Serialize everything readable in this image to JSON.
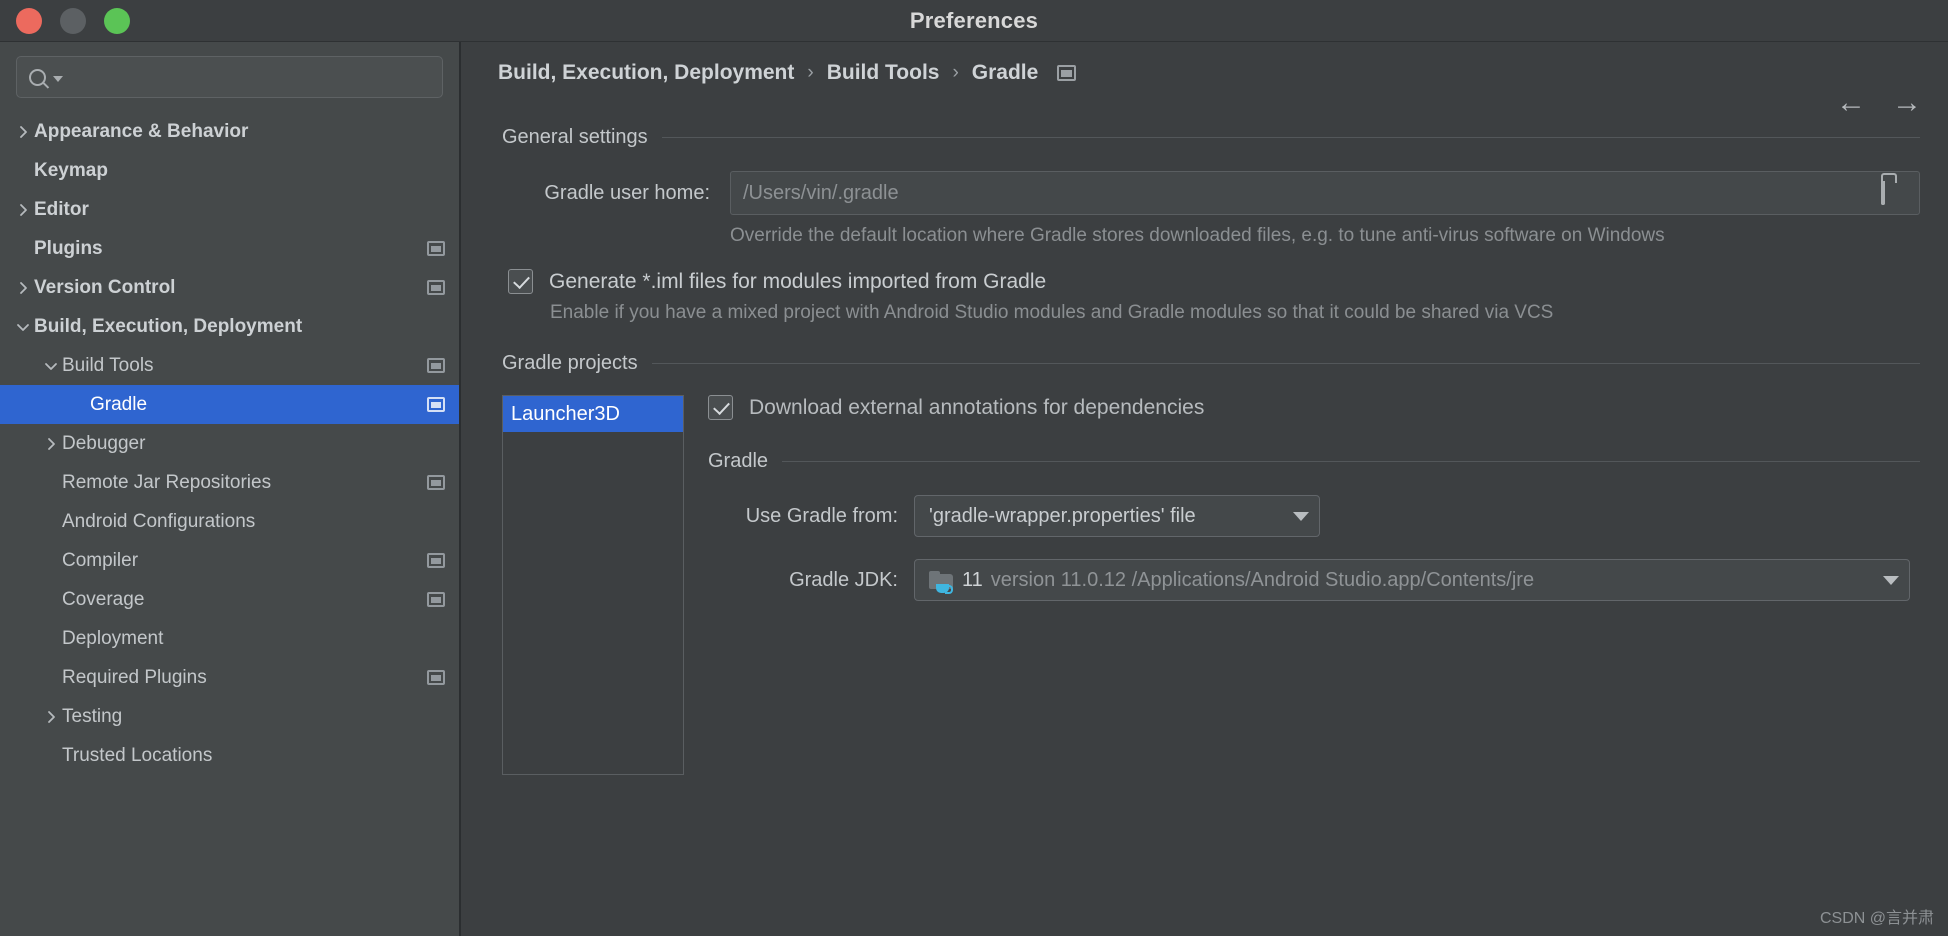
{
  "window": {
    "title": "Preferences",
    "traffic_lights": [
      "close",
      "minimize",
      "maximize"
    ]
  },
  "sidebar": {
    "search": {
      "value": "",
      "placeholder": ""
    },
    "items": [
      {
        "label": "Appearance & Behavior",
        "indent": 0,
        "chevron": "right",
        "bold": true,
        "project_icon": false,
        "selected": false
      },
      {
        "label": "Keymap",
        "indent": 0,
        "chevron": "none",
        "bold": true,
        "project_icon": false,
        "selected": false
      },
      {
        "label": "Editor",
        "indent": 0,
        "chevron": "right",
        "bold": true,
        "project_icon": false,
        "selected": false
      },
      {
        "label": "Plugins",
        "indent": 0,
        "chevron": "none",
        "bold": true,
        "project_icon": true,
        "selected": false
      },
      {
        "label": "Version Control",
        "indent": 0,
        "chevron": "right",
        "bold": true,
        "project_icon": true,
        "selected": false
      },
      {
        "label": "Build, Execution, Deployment",
        "indent": 0,
        "chevron": "down",
        "bold": true,
        "project_icon": false,
        "selected": false
      },
      {
        "label": "Build Tools",
        "indent": 1,
        "chevron": "down",
        "bold": false,
        "project_icon": true,
        "selected": false
      },
      {
        "label": "Gradle",
        "indent": 2,
        "chevron": "none",
        "bold": false,
        "project_icon": true,
        "selected": true
      },
      {
        "label": "Debugger",
        "indent": 1,
        "chevron": "right",
        "bold": false,
        "project_icon": false,
        "selected": false
      },
      {
        "label": "Remote Jar Repositories",
        "indent": 1,
        "chevron": "none",
        "bold": false,
        "project_icon": true,
        "selected": false
      },
      {
        "label": "Android Configurations",
        "indent": 1,
        "chevron": "none",
        "bold": false,
        "project_icon": false,
        "selected": false
      },
      {
        "label": "Compiler",
        "indent": 1,
        "chevron": "none",
        "bold": false,
        "project_icon": true,
        "selected": false
      },
      {
        "label": "Coverage",
        "indent": 1,
        "chevron": "none",
        "bold": false,
        "project_icon": true,
        "selected": false
      },
      {
        "label": "Deployment",
        "indent": 1,
        "chevron": "none",
        "bold": false,
        "project_icon": false,
        "selected": false
      },
      {
        "label": "Required Plugins",
        "indent": 1,
        "chevron": "none",
        "bold": false,
        "project_icon": true,
        "selected": false
      },
      {
        "label": "Testing",
        "indent": 1,
        "chevron": "right",
        "bold": false,
        "project_icon": false,
        "selected": false
      },
      {
        "label": "Trusted Locations",
        "indent": 1,
        "chevron": "none",
        "bold": false,
        "project_icon": false,
        "selected": false
      }
    ]
  },
  "breadcrumb": {
    "parts": [
      "Build, Execution, Deployment",
      "Build Tools",
      "Gradle"
    ],
    "separator": "›",
    "back_arrow": "←",
    "forward_arrow": "→"
  },
  "general_settings": {
    "section_title": "General settings",
    "gradle_user_home_label": "Gradle user home:",
    "gradle_user_home_value": "",
    "gradle_user_home_placeholder": "/Users/vin/.gradle",
    "gradle_user_home_hint": "Override the default location where Gradle stores downloaded files, e.g. to tune anti-virus software on Windows",
    "generate_iml_label": "Generate *.iml files for modules imported from Gradle",
    "generate_iml_checked": true,
    "generate_iml_hint": "Enable if you have a mixed project with Android Studio modules and Gradle modules so that it could be shared via VCS"
  },
  "gradle_projects": {
    "section_title": "Gradle projects",
    "projects": [
      "Launcher3D"
    ],
    "selected_project": "Launcher3D",
    "download_annotations_label": "Download external annotations for dependencies",
    "download_annotations_checked": true,
    "gradle_subsection_title": "Gradle",
    "use_gradle_from_label": "Use Gradle from:",
    "use_gradle_from_value": "'gradle-wrapper.properties' file",
    "gradle_jdk_label": "Gradle JDK:",
    "gradle_jdk_version": "11",
    "gradle_jdk_path": "version 11.0.12 /Applications/Android Studio.app/Contents/jre"
  },
  "watermark": "CSDN @言并肃",
  "colors": {
    "accent_selection": "#2f65d0",
    "window_bg": "#3c3f41",
    "sidebar_bg": "#45494a",
    "text_primary": "#c9cdd0",
    "text_dim": "#8b8f92",
    "jdk_cup": "#3fb6e0"
  }
}
